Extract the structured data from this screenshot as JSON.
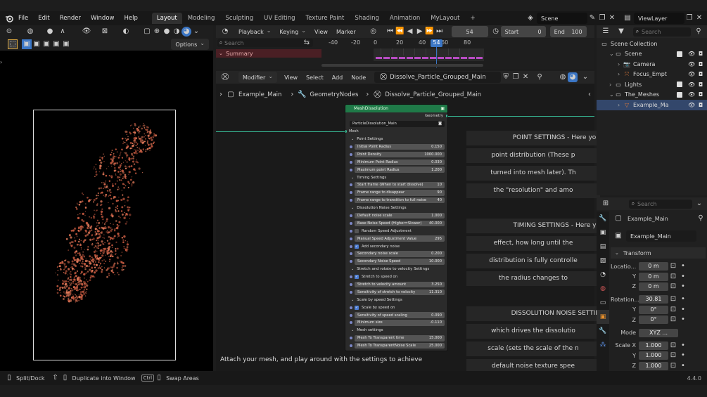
{
  "menu": {
    "items": [
      "File",
      "Edit",
      "Render",
      "Window",
      "Help"
    ],
    "workspaces": [
      "Layout",
      "Modeling",
      "Sculpting",
      "UV Editing",
      "Texture Paint",
      "Shading",
      "Animation",
      "MyLayout"
    ],
    "active_workspace": "Layout",
    "add_tab": "+",
    "scene_label": "Scene",
    "viewlayer_label": "ViewLayer"
  },
  "viewport": {
    "options_label": "Options"
  },
  "timeline": {
    "playback_label": "Playback",
    "keying_label": "Keying",
    "view_label": "View",
    "marker_label": "Marker",
    "current_frame": "54",
    "start_label": "Start",
    "start_value": "0",
    "end_label": "End",
    "end_value": "100",
    "search_placeholder": "Search",
    "summary_label": "Summary",
    "ruler": [
      "-40",
      "-20",
      "0",
      "20",
      "40",
      "54",
      "60",
      "80"
    ]
  },
  "node_editor": {
    "modifier_label": "Modifier",
    "menus": [
      "View",
      "Select",
      "Add",
      "Node"
    ],
    "node_tree_name": "Dissolve_Particle_Grouped_Main",
    "breadcrumb": [
      "Example_Main",
      "GeometryNodes",
      "Dissolve_Particle_Grouped_Main"
    ],
    "node": {
      "title": "MeshDissolution",
      "output_socket": "Geometry",
      "group_name": "ParticleDissolution_Main",
      "input_socket": "Mesh",
      "rows": [
        {
          "kind": "header",
          "label": "Point Settings"
        },
        {
          "kind": "field",
          "label": "Initial Point Radius",
          "value": "0.150"
        },
        {
          "kind": "field",
          "label": "Point Density",
          "value": "1000.000"
        },
        {
          "kind": "field",
          "label": "Minimum Point Radius",
          "value": "0.030"
        },
        {
          "kind": "field",
          "label": "Maximum point Radius",
          "value": "1.200"
        },
        {
          "kind": "header",
          "label": "Timing Settings"
        },
        {
          "kind": "field",
          "label": "Start frame (When to start dissolve)",
          "value": "10"
        },
        {
          "kind": "field",
          "label": "Frame range to disappear",
          "value": "90"
        },
        {
          "kind": "field",
          "label": "Frame range to transition to full noise",
          "value": "40"
        },
        {
          "kind": "header",
          "label": "Dissolution Noise Settings"
        },
        {
          "kind": "field",
          "label": "Default noise scale",
          "value": "1.000"
        },
        {
          "kind": "field",
          "label": "Base Noise Speed (Higher=Slower)",
          "value": "40.000"
        },
        {
          "kind": "check",
          "label": "Random Speed Adjustment",
          "checked": false
        },
        {
          "kind": "field",
          "label": "Manual Speed Adjustment Value",
          "value": "295"
        },
        {
          "kind": "check",
          "label": "Add secondary noise",
          "checked": true
        },
        {
          "kind": "field",
          "label": "Secondary noise scale",
          "value": "0.200"
        },
        {
          "kind": "field",
          "label": "Secondary Noise Speed",
          "value": "10.000"
        },
        {
          "kind": "header",
          "label": "Stretch and rotate to velocity Settings"
        },
        {
          "kind": "check",
          "label": "Stretch to speed on",
          "checked": true
        },
        {
          "kind": "field",
          "label": "Stretch to velocity amount",
          "value": "3.250"
        },
        {
          "kind": "field",
          "label": "Sensitivity of stretch to velocity",
          "value": "11.310"
        },
        {
          "kind": "header",
          "label": "Scale by speed Settings"
        },
        {
          "kind": "check",
          "label": "Scale by speed on",
          "checked": true
        },
        {
          "kind": "field",
          "label": "Sensitivity of speed scaling",
          "value": "0.090"
        },
        {
          "kind": "field",
          "label": "Minimum size",
          "value": "-0.110"
        },
        {
          "kind": "header",
          "label": "Mesh settings"
        },
        {
          "kind": "field",
          "label": "Mesh To Transparent time",
          "value": "15.000"
        },
        {
          "kind": "field",
          "label": "Mesh To TransparentNoise Scale",
          "value": "25.000"
        }
      ]
    },
    "notes": [
      "POINT SETTINGS - Here you",
      "point distribution (These p",
      "turned into mesh later). Th",
      "the \"resolution\" and amo",
      "TIMING SETTINGS - Here yo",
      "effect, how long until the",
      "distribution is fully controlle",
      "the radius changes to",
      "DISSOLUTION NOISE SETTIN",
      "which drives the dissolutio",
      "scale (sets the scale of the n",
      "default noise texture spee"
    ],
    "hint": "Attach your mesh, and play around with the settings to achieve"
  },
  "outliner": {
    "search_placeholder": "Search",
    "items": [
      {
        "label": "Scene Collection",
        "depth": 0,
        "icon": "collection-icon",
        "selected": false,
        "checkbox": false
      },
      {
        "label": "Scene",
        "depth": 1,
        "icon": "collection-icon",
        "selected": false,
        "checkbox": true
      },
      {
        "label": "Camera",
        "depth": 2,
        "icon": "camera-icon",
        "selected": false,
        "checkbox": false
      },
      {
        "label": "Focus_Empt",
        "depth": 2,
        "icon": "empty-icon",
        "selected": false,
        "checkbox": false
      },
      {
        "label": "Lights",
        "depth": 1,
        "icon": "collection-icon",
        "selected": false,
        "checkbox": true
      },
      {
        "label": "The_Meshes",
        "depth": 1,
        "icon": "collection-icon",
        "selected": false,
        "checkbox": true
      },
      {
        "label": "Example_Ma",
        "depth": 2,
        "icon": "mesh-icon",
        "selected": true,
        "checkbox": false
      }
    ]
  },
  "properties": {
    "search_placeholder": "Search",
    "object_name": "Example_Main",
    "data_name": "Example_Main",
    "transform_label": "Transform",
    "location_label": "Locatio...",
    "location": [
      "0 m",
      "0 m",
      "0 m"
    ],
    "rotation_label": "Rotation...",
    "rotation": [
      "30.81",
      "0°",
      "0°"
    ],
    "mode_label": "Mode",
    "mode_value": "XYZ ...",
    "scale_label": "Scale X",
    "scale": [
      "1.000",
      "1.000",
      "1.000"
    ],
    "axis_labels": [
      "Y",
      "Z"
    ]
  },
  "status": {
    "split_dock": "Split/Dock",
    "duplicate": "Duplicate into Window",
    "ctrl_key": "Ctrl",
    "swap": "Swap Areas",
    "version": "4.4.0"
  },
  "colors": {
    "node_header": "#1f7a48",
    "selection": "#3b76c5",
    "keyframe": "#b84cc4",
    "summary": "#4a1f24",
    "wire": "#38c09a",
    "particles": "#c0573e"
  }
}
